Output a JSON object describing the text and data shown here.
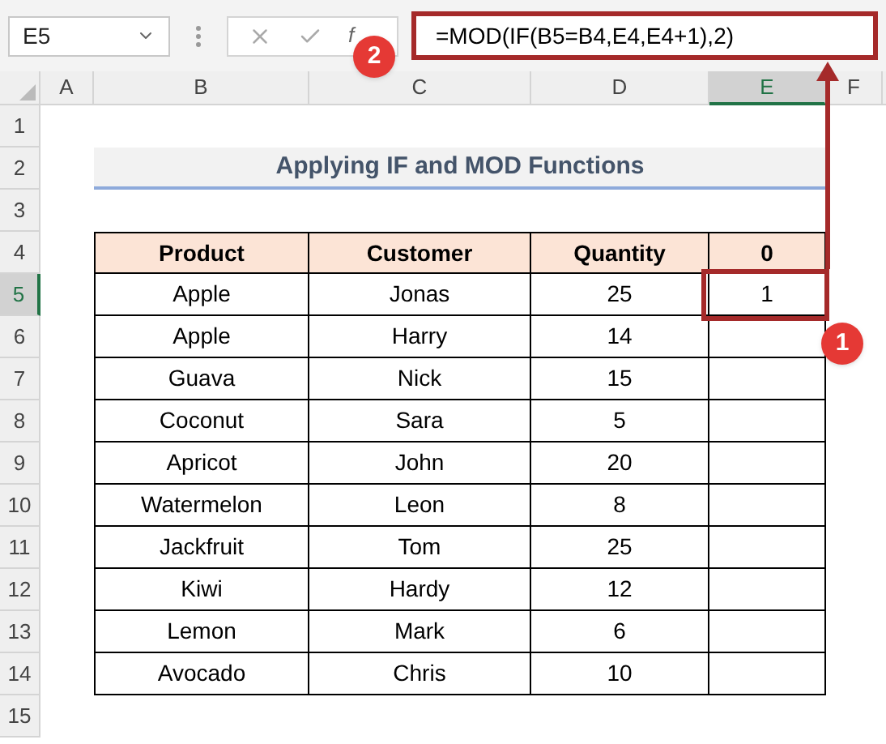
{
  "name_box": "E5",
  "fx_label": "f",
  "formula": "=MOD(IF(B5=B4,E4,E4+1),2)",
  "columns": [
    {
      "label": "A",
      "selected": false
    },
    {
      "label": "B",
      "selected": false
    },
    {
      "label": "C",
      "selected": false
    },
    {
      "label": "D",
      "selected": false
    },
    {
      "label": "E",
      "selected": true
    },
    {
      "label": "F",
      "selected": false
    }
  ],
  "rows": [
    {
      "label": "1",
      "selected": false
    },
    {
      "label": "2",
      "selected": false
    },
    {
      "label": "3",
      "selected": false
    },
    {
      "label": "4",
      "selected": false
    },
    {
      "label": "5",
      "selected": true
    },
    {
      "label": "6",
      "selected": false
    },
    {
      "label": "7",
      "selected": false
    },
    {
      "label": "8",
      "selected": false
    },
    {
      "label": "9",
      "selected": false
    },
    {
      "label": "10",
      "selected": false
    },
    {
      "label": "11",
      "selected": false
    },
    {
      "label": "12",
      "selected": false
    },
    {
      "label": "13",
      "selected": false
    },
    {
      "label": "14",
      "selected": false
    },
    {
      "label": "15",
      "selected": false
    }
  ],
  "title": "Applying IF and MOD Functions",
  "table": {
    "header": [
      "Product",
      "Customer",
      "Quantity",
      "0"
    ],
    "rows": [
      [
        "Apple",
        "Jonas",
        "25",
        "1"
      ],
      [
        "Apple",
        "Harry",
        "14"
      ],
      [
        "Guava",
        "Nick",
        "15"
      ],
      [
        "Coconut",
        "Sara",
        "5"
      ],
      [
        "Apricot",
        "John",
        "20"
      ],
      [
        "Watermelon",
        "Leon",
        "8"
      ],
      [
        "Jackfruit",
        "Tom",
        "25"
      ],
      [
        "Kiwi",
        "Hardy",
        "12"
      ],
      [
        "Lemon",
        "Mark",
        "6"
      ],
      [
        "Avocado",
        "Chris",
        "10"
      ]
    ]
  },
  "callouts": [
    "1",
    "2"
  ]
}
